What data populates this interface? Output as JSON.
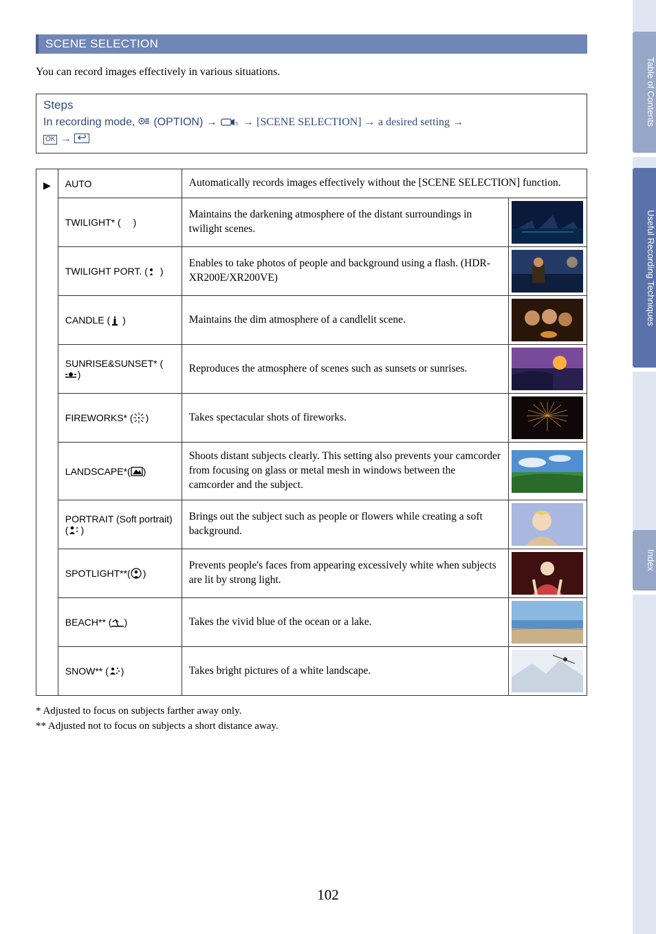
{
  "section_header": "SCENE SELECTION",
  "intro": "You can record images effectively in various situations.",
  "steps": {
    "title": "Steps",
    "prefix": "In recording mode, ",
    "option_label": " (OPTION) ",
    "arrow": "→",
    "bracket": " [SCENE SELECTION] ",
    "suffix": " a desired setting ",
    "ok_label": "OK"
  },
  "rows": [
    {
      "mark": "▶",
      "name": "AUTO",
      "icon": "",
      "desc": "Automatically records images effectively without the [SCENE SELECTION] function.",
      "thumb": false
    },
    {
      "mark": "",
      "name": "TWILIGHT* (",
      "icon": "moon",
      "name_suffix": ")",
      "desc": "Maintains the darkening atmosphere of the distant surroundings in twilight scenes.",
      "thumb": true
    },
    {
      "mark": "",
      "name": "TWILIGHT PORT. (",
      "icon": "twilight-port",
      "name_suffix": ")",
      "desc": "Enables to take photos of people and background using a flash. (HDR-XR200E/XR200VE)",
      "thumb": true
    },
    {
      "mark": "",
      "name": "CANDLE (",
      "icon": "candle",
      "name_suffix": ")",
      "desc": "Maintains the dim atmosphere of a candlelit scene.",
      "thumb": true
    },
    {
      "mark": "",
      "name": "SUNRISE&SUNSET* (",
      "icon": "sunset",
      "name_suffix": ")",
      "desc": "Reproduces the atmosphere of scenes such as sunsets or sunrises.",
      "thumb": true
    },
    {
      "mark": "",
      "name": "FIREWORKS* (",
      "icon": "fireworks",
      "name_suffix": ")",
      "desc": "Takes spectacular shots of fireworks.",
      "thumb": true
    },
    {
      "mark": "",
      "name": "LANDSCAPE*(",
      "icon": "landscape",
      "name_suffix": ")",
      "desc": "Shoots distant subjects clearly. This setting also prevents your camcorder from focusing on glass or metal mesh in windows between the camcorder and the subject.",
      "thumb": true
    },
    {
      "mark": "",
      "name": "PORTRAIT (Soft portrait) (",
      "icon": "portrait",
      "name_suffix": ")",
      "desc": "Brings out the subject such as people or flowers while creating a soft background.",
      "thumb": true
    },
    {
      "mark": "",
      "name": "SPOTLIGHT**(",
      "icon": "spotlight",
      "name_suffix": ")",
      "desc": "Prevents people's faces from appearing excessively white when subjects are lit by strong light.",
      "thumb": true
    },
    {
      "mark": "",
      "name": "BEACH** (",
      "icon": "beach",
      "name_suffix": ")",
      "desc": "Takes the vivid blue of the ocean or a lake.",
      "thumb": true
    },
    {
      "mark": "",
      "name": "SNOW** (",
      "icon": "snow",
      "name_suffix": ")",
      "desc": "Takes bright pictures of a white landscape.",
      "thumb": true
    }
  ],
  "footnotes": [
    "*   Adjusted to focus on subjects farther away only.",
    "** Adjusted not to focus on subjects a short distance away."
  ],
  "page_number": "102",
  "tabs": [
    {
      "label": "Table of Contents",
      "active": false
    },
    {
      "label": "Useful Recording Techniques",
      "active": true
    },
    {
      "label": "Index",
      "active": false
    }
  ]
}
